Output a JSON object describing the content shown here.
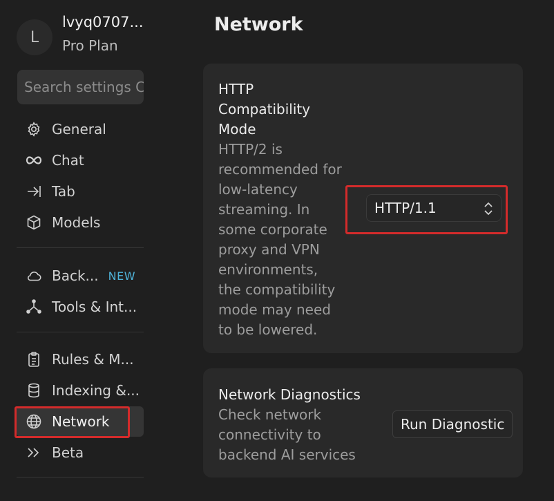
{
  "user": {
    "initial": "L",
    "name": "lvyq0707...",
    "plan": "Pro Plan"
  },
  "search": {
    "placeholder": "Search settings C"
  },
  "sidebar": {
    "items": [
      {
        "label": "General",
        "icon": "gear-icon"
      },
      {
        "label": "Chat",
        "icon": "infinity-icon"
      },
      {
        "label": "Tab",
        "icon": "arrow-right-bar-icon"
      },
      {
        "label": "Models",
        "icon": "cube-icon"
      },
      {
        "label": "Back...",
        "icon": "cloud-icon",
        "badge": "NEW"
      },
      {
        "label": "Tools & Int...",
        "icon": "nodes-icon"
      },
      {
        "label": "Rules & M...",
        "icon": "clipboard-icon"
      },
      {
        "label": "Indexing &...",
        "icon": "database-icon"
      },
      {
        "label": "Network",
        "icon": "globe-icon",
        "active": true
      },
      {
        "label": "Beta",
        "icon": "double-chevron-icon"
      }
    ]
  },
  "page": {
    "title": "Network"
  },
  "http_mode": {
    "title": "HTTP Compatibility Mode",
    "description": "HTTP/2 is recommended for low-latency streaming. In some corporate proxy and VPN environments, the compatibility mode may need to be lowered.",
    "selected": "HTTP/1.1"
  },
  "diagnostics": {
    "title": "Network Diagnostics",
    "description": "Check network connectivity to backend AI services",
    "button": "Run Diagnostic"
  },
  "colors": {
    "highlight": "#d42b2b",
    "badge": "#4fb3d9",
    "background": "#1f1f1f",
    "card": "#292929"
  }
}
